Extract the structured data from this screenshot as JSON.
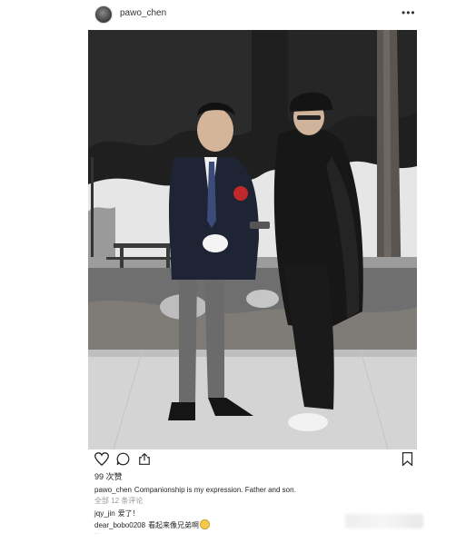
{
  "post": {
    "username": "pawo_chen",
    "more": "•••"
  },
  "photo": {
    "alt_icon": "photo-image"
  },
  "actions": {
    "icons": [
      "heart-icon",
      "comment-icon",
      "share-icon",
      "bookmark-icon"
    ]
  },
  "likes": "99 次赞",
  "caption": {
    "username": "pawo_chen",
    "text": "Companionship is my expression. Father and son."
  },
  "view_all_comments": "全部 12 条评论",
  "comments": [
    {
      "username": "jqy_jin",
      "text": "爱了！"
    },
    {
      "username": "dear_bobo0208",
      "text": "看起来像兄弟啊"
    }
  ],
  "timestamp": "...",
  "colors": {
    "text": "#262626",
    "muted": "#999999",
    "background": "#ffffff"
  }
}
